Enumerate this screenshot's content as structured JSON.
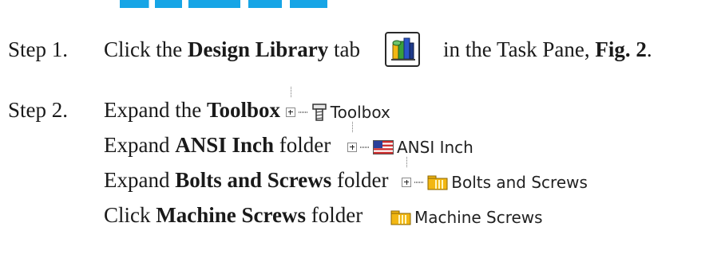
{
  "step1": {
    "label": "Step 1.",
    "text_before": "Click the ",
    "bold_design_library": "Design Library",
    "text_tab": " tab",
    "text_after": " in the Task Pane, ",
    "bold_fig": "Fig. 2",
    "period": "."
  },
  "step2": {
    "label": "Step 2.",
    "line1": {
      "text": "Expand the ",
      "bold": "Toolbox",
      "ui_label": "Toolbox"
    },
    "line2": {
      "text": "Expand ",
      "bold": "ANSI Inch",
      "suffix": " folder",
      "ui_label": "ANSI Inch"
    },
    "line3": {
      "text": "Expand ",
      "bold": "Bolts and Screws",
      "suffix": " folder",
      "ui_label": "Bolts and Screws"
    },
    "line4": {
      "text": "Click ",
      "bold": "Machine Screws",
      "suffix": " folder",
      "ui_label": "Machine Screws"
    }
  },
  "colors": {
    "heading_accent": "#17a5e6",
    "folder_yellow": "#f2b713",
    "flag_red": "#cc2b2b",
    "flag_blue": "#2a3f9a"
  },
  "icons": {
    "design_library_tab": "design-library-icon",
    "toolbox": "toolbox-screw-icon",
    "ansi_inch": "us-flag-icon",
    "folder": "folder-icon"
  }
}
